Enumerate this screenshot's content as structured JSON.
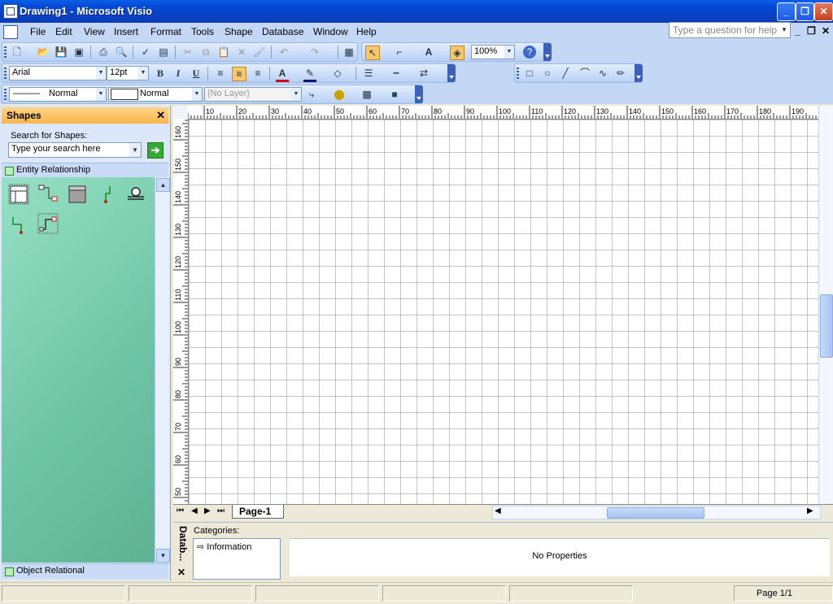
{
  "window": {
    "title": "Drawing1 - Microsoft Visio",
    "controls": {
      "minimize": "_",
      "maximize": "❐",
      "close": "✕"
    }
  },
  "menu": {
    "items": [
      "File",
      "Edit",
      "View",
      "Insert",
      "Format",
      "Tools",
      "Shape",
      "Database",
      "Window",
      "Help"
    ],
    "help_placeholder": "Type a question for help"
  },
  "toolbar_standard": {
    "zoom": "100%"
  },
  "toolbar_formatting": {
    "font": "Arial",
    "size": "12pt",
    "bold": "B",
    "italic": "I",
    "underline": "U",
    "font_color": "A"
  },
  "toolbar_format_shape": {
    "line_style": "Normal",
    "fill_style": "Normal",
    "layer": "{No Layer}"
  },
  "shapes_pane": {
    "title": "Shapes",
    "close": "✕",
    "search_label": "Search for Shapes:",
    "search_placeholder": "Type your search here",
    "stencils": [
      "Entity Relationship",
      "Object Relational"
    ],
    "shape_icons": [
      "entity-icon",
      "relationship-icon",
      "view-icon",
      "parent-to-category-icon",
      "category-icon",
      "category-to-child-icon",
      "dynamic-connector-icon"
    ]
  },
  "rulers": {
    "horizontal": [
      "10",
      "20",
      "30",
      "40",
      "50",
      "60",
      "70",
      "80",
      "90",
      "100",
      "110",
      "120",
      "130",
      "140",
      "150",
      "160",
      "170",
      "180",
      "190",
      "20"
    ],
    "vertical": [
      "160",
      "150",
      "140",
      "130",
      "120",
      "110",
      "100",
      "90",
      "80",
      "70",
      "60",
      "50"
    ]
  },
  "page_tabs": [
    "Page-1"
  ],
  "database_properties": {
    "title": "Datab...",
    "categories_label": "Categories:",
    "categories": [
      "Information"
    ],
    "no_properties": "No Properties"
  },
  "statusbar": {
    "page": "Page 1/1"
  }
}
